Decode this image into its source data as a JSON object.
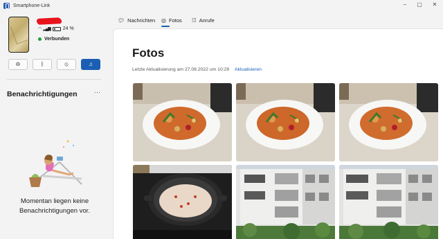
{
  "window": {
    "title": "Smartphone-Link",
    "min": "–",
    "max": "▢",
    "close": "✕"
  },
  "device": {
    "battery": "24 %",
    "status": "Verbunden"
  },
  "quick_actions": [
    {
      "icon": "do-not-disturb-icon",
      "glyph": "⊖"
    },
    {
      "icon": "bluetooth-icon",
      "glyph": "ᛒ"
    },
    {
      "icon": "silent-mode-icon",
      "glyph": "⦸"
    },
    {
      "icon": "music-note-icon",
      "glyph": "♫"
    }
  ],
  "notifications": {
    "title": "Benachrichtigungen",
    "more": "···",
    "empty_line1": "Momentan liegen keine",
    "empty_line2": "Benachrichtigungen vor."
  },
  "tabs": [
    {
      "label": "Nachrichten",
      "icon": "chat-icon"
    },
    {
      "label": "Fotos",
      "icon": "photos-icon",
      "active": true
    },
    {
      "label": "Anrufe",
      "icon": "dialpad-icon"
    }
  ],
  "photos": {
    "title": "Fotos",
    "updated": "Letzte Aktualisierung am 27.08.2022 um 10:29",
    "refresh": "Aktualisieren",
    "items": [
      {
        "subject": "food-plate"
      },
      {
        "subject": "food-plate"
      },
      {
        "subject": "food-plate"
      },
      {
        "subject": "cooking-pot"
      },
      {
        "subject": "building"
      },
      {
        "subject": "building"
      }
    ]
  },
  "colors": {
    "accent": "#1a5fb4",
    "connected": "#1f9e3d"
  }
}
